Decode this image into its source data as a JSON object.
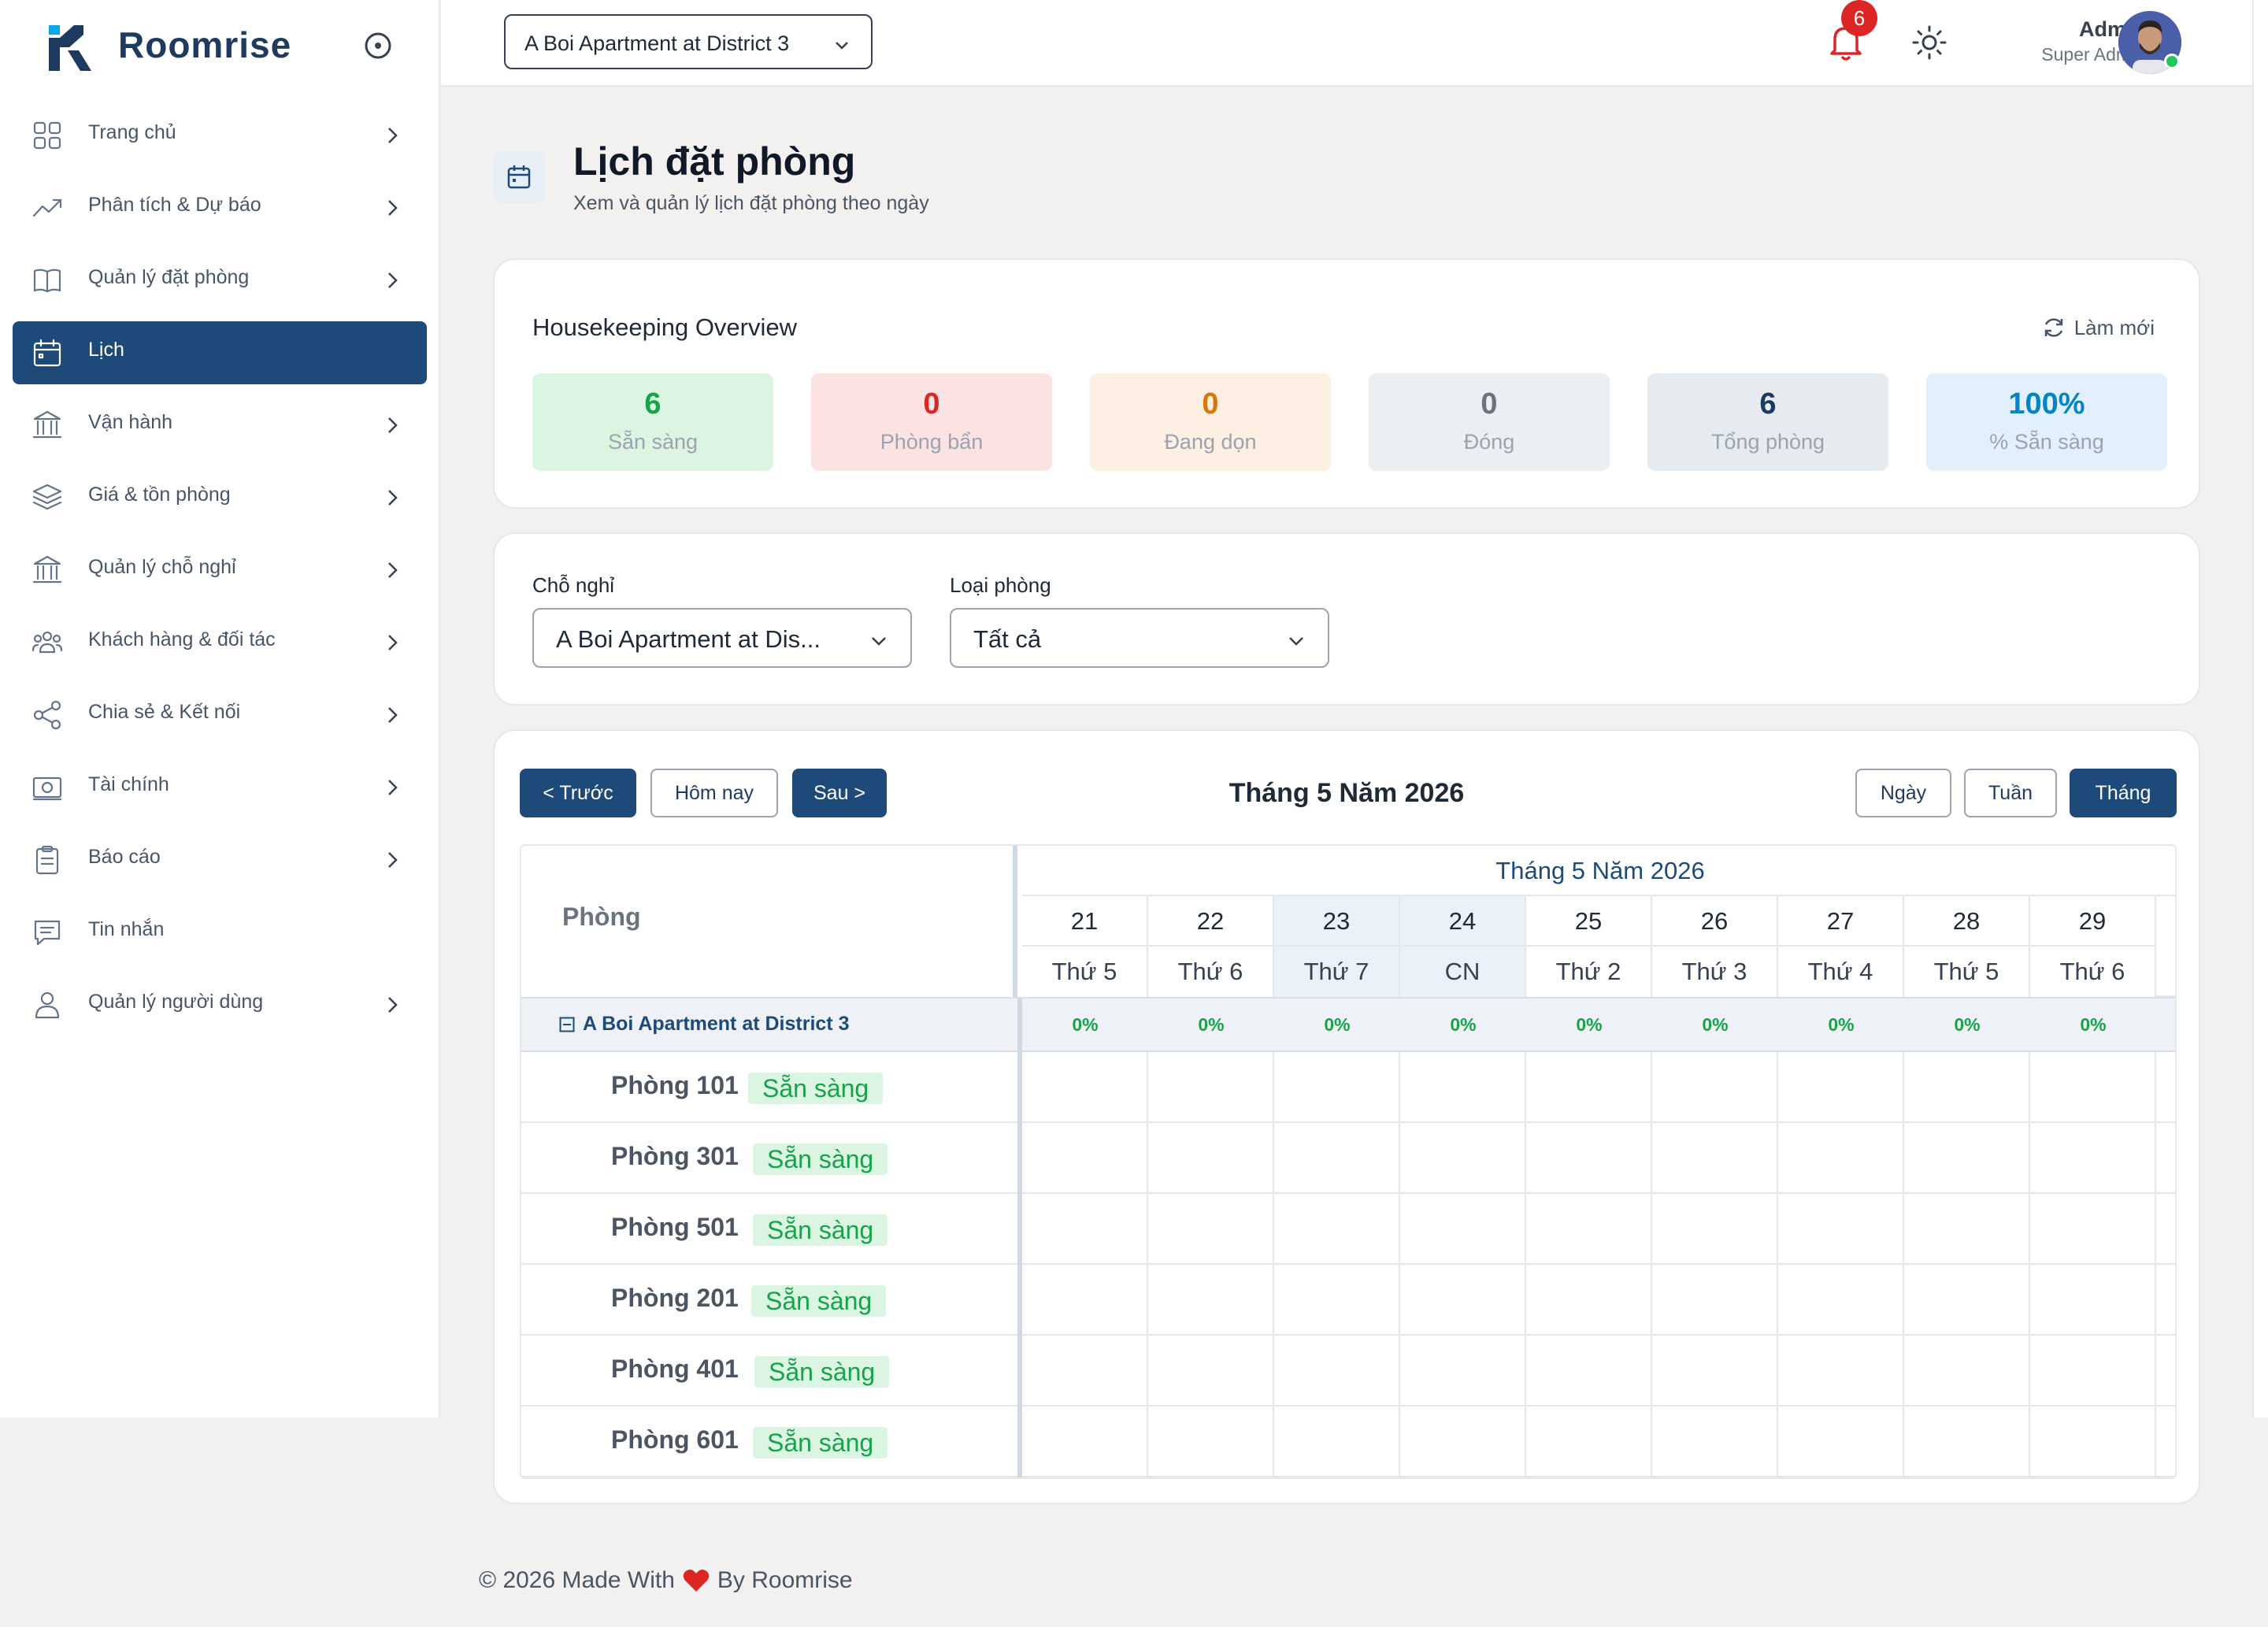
{
  "app": {
    "name": "Roomrise"
  },
  "sidebar": {
    "items": [
      {
        "label": "Trang chủ",
        "icon": "grid-icon",
        "has_chevron": true,
        "active": false
      },
      {
        "label": "Phân tích & Dự báo",
        "icon": "trend-up-icon",
        "has_chevron": true,
        "active": false
      },
      {
        "label": "Quản lý đặt phòng",
        "icon": "book-icon",
        "has_chevron": true,
        "active": false
      },
      {
        "label": "Lịch",
        "icon": "calendar-icon",
        "has_chevron": false,
        "active": true
      },
      {
        "label": "Vận hành",
        "icon": "bank-icon",
        "has_chevron": true,
        "active": false
      },
      {
        "label": "Giá & tồn phòng",
        "icon": "layers-icon",
        "has_chevron": true,
        "active": false
      },
      {
        "label": "Quản lý chỗ nghỉ",
        "icon": "building-icon",
        "has_chevron": true,
        "active": false
      },
      {
        "label": "Khách hàng & đối tác",
        "icon": "users-icon",
        "has_chevron": true,
        "active": false
      },
      {
        "label": "Chia sẻ & Kết nối",
        "icon": "share-icon",
        "has_chevron": true,
        "active": false
      },
      {
        "label": "Tài chính",
        "icon": "money-icon",
        "has_chevron": true,
        "active": false
      },
      {
        "label": "Báo cáo",
        "icon": "clipboard-icon",
        "has_chevron": true,
        "active": false
      },
      {
        "label": "Tin nhắn",
        "icon": "message-icon",
        "has_chevron": false,
        "active": false
      },
      {
        "label": "Quản lý người dùng",
        "icon": "user-icon",
        "has_chevron": true,
        "active": false
      }
    ]
  },
  "topbar": {
    "property_select": "A Boi Apartment at District 3",
    "notification_count": "6",
    "user_name": "Admin",
    "user_role": "Super Admin"
  },
  "page": {
    "title": "Lịch đặt phòng",
    "subtitle": "Xem và quản lý lịch đặt phòng theo ngày"
  },
  "housekeeping": {
    "title": "Housekeeping Overview",
    "refresh_label": "Làm mới",
    "stats": [
      {
        "value": "6",
        "label": "Sẵn sàng",
        "color": "#16a34a",
        "bg": "#dcf5e3"
      },
      {
        "value": "0",
        "label": "Phòng bẩn",
        "color": "#dc2626",
        "bg": "#fbe3e3"
      },
      {
        "value": "0",
        "label": "Đang dọn",
        "color": "#d97706",
        "bg": "#fdefe2"
      },
      {
        "value": "0",
        "label": "Đóng",
        "color": "#6b7280",
        "bg": "#eceff2"
      },
      {
        "value": "6",
        "label": "Tổng phòng",
        "color": "#1e3a5f",
        "bg": "#e6ebf0"
      },
      {
        "value": "100%",
        "label": "% Sẵn sàng",
        "color": "#0284c7",
        "bg": "#e1f0fa"
      }
    ]
  },
  "filters": {
    "property_label": "Chỗ nghỉ",
    "property_value": "A Boi Apartment at Dis...",
    "room_type_label": "Loại phòng",
    "room_type_value": "Tất cả"
  },
  "calendar": {
    "prev_label": "< Trước",
    "today_label": "Hôm nay",
    "next_label": "Sau >",
    "title": "Tháng 5 Năm 2026",
    "views": {
      "day": "Ngày",
      "week": "Tuần",
      "month": "Tháng",
      "active": "month"
    },
    "room_column_label": "Phòng",
    "month_header": "Tháng 5 Năm 2026",
    "days": [
      {
        "num": "21",
        "name": "Thứ 5",
        "weekend": false,
        "pct": "0%"
      },
      {
        "num": "22",
        "name": "Thứ 6",
        "weekend": false,
        "pct": "0%"
      },
      {
        "num": "23",
        "name": "Thứ 7",
        "weekend": true,
        "pct": "0%"
      },
      {
        "num": "24",
        "name": "CN",
        "weekend": true,
        "pct": "0%"
      },
      {
        "num": "25",
        "name": "Thứ 2",
        "weekend": false,
        "pct": "0%"
      },
      {
        "num": "26",
        "name": "Thứ 3",
        "weekend": false,
        "pct": "0%"
      },
      {
        "num": "27",
        "name": "Thứ 4",
        "weekend": false,
        "pct": "0%"
      },
      {
        "num": "28",
        "name": "Thứ 5",
        "weekend": false,
        "pct": "0%"
      },
      {
        "num": "29",
        "name": "Thứ 6",
        "weekend": false,
        "pct": "0%"
      }
    ],
    "property_group": "A Boi Apartment at District 3",
    "rooms": [
      {
        "name": "Phòng 101",
        "status": "Sẵn sàng"
      },
      {
        "name": "Phòng 301",
        "status": "Sẵn sàng"
      },
      {
        "name": "Phòng 501",
        "status": "Sẵn sàng"
      },
      {
        "name": "Phòng 201",
        "status": "Sẵn sàng"
      },
      {
        "name": "Phòng 401",
        "status": "Sẵn sàng"
      },
      {
        "name": "Phòng 601",
        "status": "Sẵn sàng"
      }
    ]
  },
  "footer": {
    "before": "© 2026 Made With",
    "after": "By Roomrise"
  }
}
